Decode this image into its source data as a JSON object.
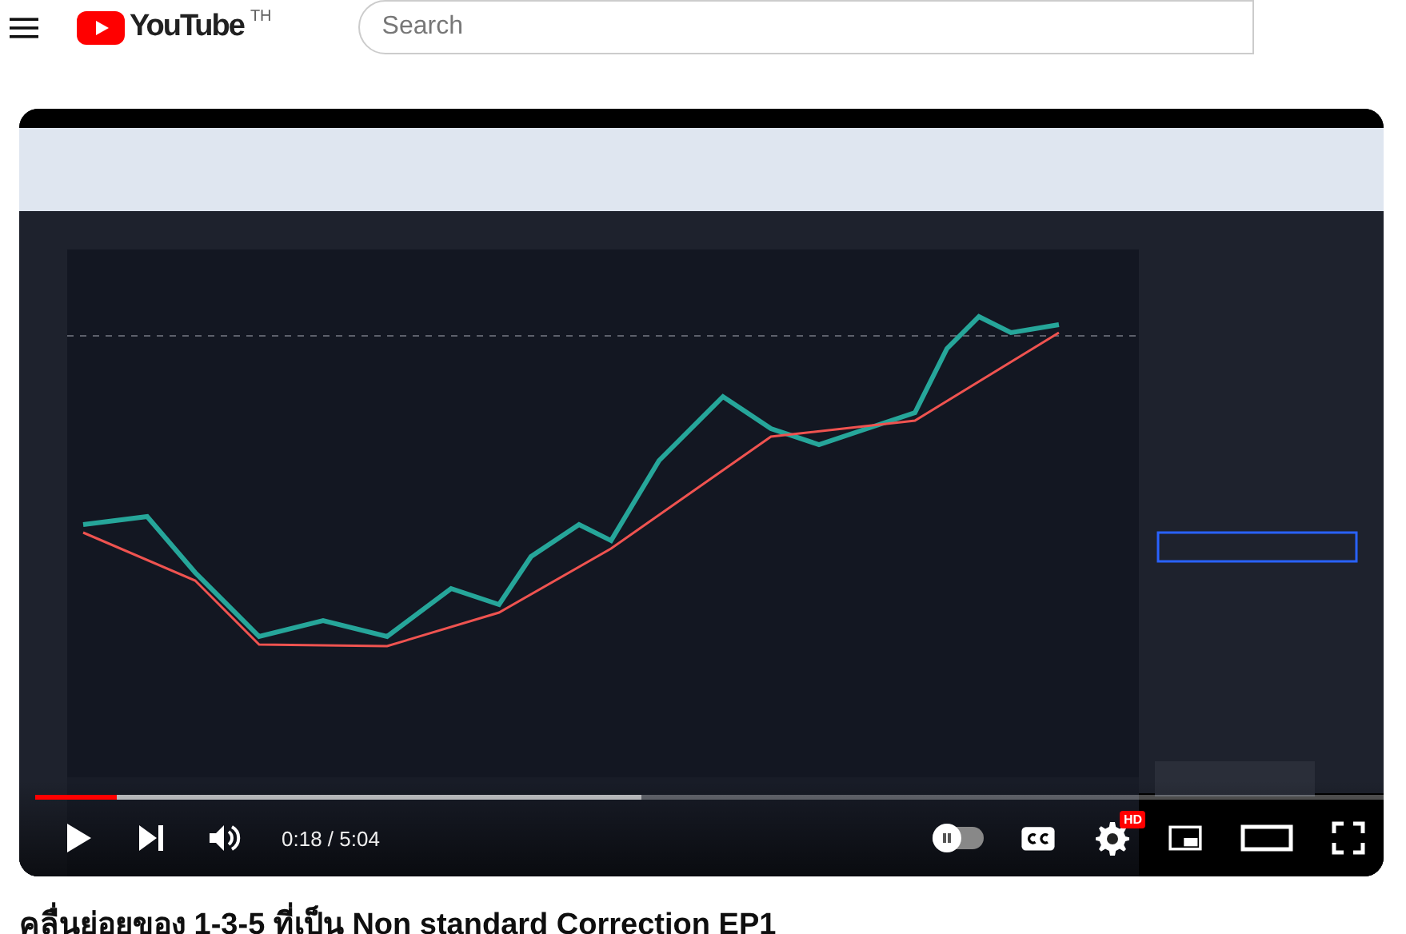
{
  "header": {
    "logo_text": "YouTube",
    "country_code": "TH",
    "search": {
      "placeholder": "Search"
    }
  },
  "player": {
    "progress": {
      "level": 0.06
    },
    "buffer": {
      "level": 0.45
    },
    "time": "0:18 / 5:04",
    "autoplay": {
      "on": false
    },
    "quality_badge": "HD"
  },
  "video_title": "คลื่นย่อยของ 1-3-5 ที่เป็น Non standard Correction EP1"
}
